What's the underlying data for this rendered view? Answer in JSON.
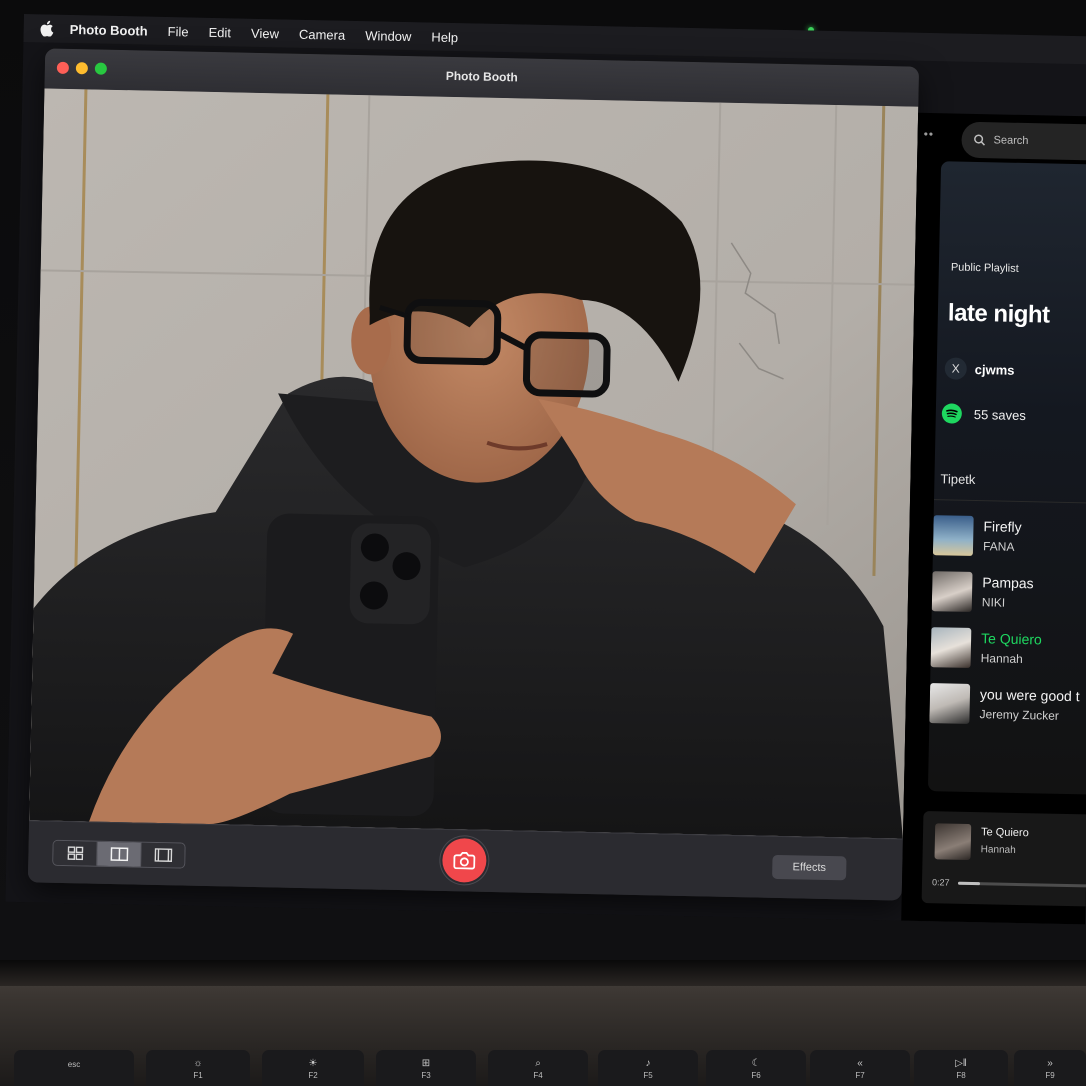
{
  "menubar": {
    "items": [
      "Photo Booth",
      "File",
      "Edit",
      "View",
      "Camera",
      "Window",
      "Help"
    ]
  },
  "photobooth": {
    "window_title": "Photo Booth",
    "effects_label": "Effects",
    "layout_modes": [
      "grid-view-icon",
      "split-view-icon",
      "single-view-icon"
    ],
    "active_layout": "split-view-icon",
    "shutter_color": "#f0474b"
  },
  "spotify": {
    "search_placeholder": "Search",
    "playlist_type": "Public Playlist",
    "playlist_name": "late night",
    "owner": "cjwms",
    "saves": "55 saves",
    "section_label": "Tipetk",
    "accent": "#1ed760",
    "tracks": [
      {
        "title": "Firefly",
        "artist": "FANA",
        "playing": false
      },
      {
        "title": "Pampas",
        "artist": "NIKI",
        "playing": false
      },
      {
        "title": "Te Quiero",
        "artist": "Hannah",
        "playing": true
      },
      {
        "title": "you were good t",
        "artist": "Jeremy Zucker",
        "playing": false
      }
    ],
    "now_playing": {
      "title": "Te Quiero",
      "artist": "Hannah",
      "elapsed": "0:27",
      "progress": 0.16
    }
  },
  "keyboard": {
    "keys": [
      "esc",
      "F1",
      "F2",
      "F3",
      "F4",
      "F5",
      "F6",
      "F7",
      "F8",
      "F9"
    ]
  }
}
